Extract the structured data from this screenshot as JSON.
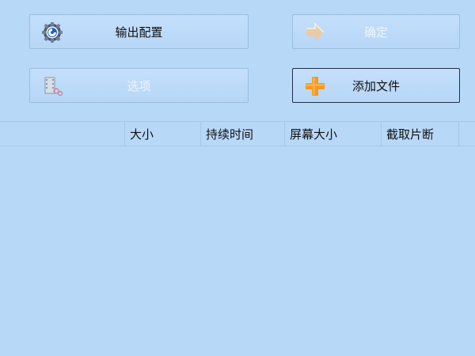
{
  "buttons": {
    "output_config": "输出配置",
    "confirm": "确定",
    "options": "选项",
    "add_file": "添加文件"
  },
  "table": {
    "columns": [
      "",
      "大小",
      "持续时间",
      "屏幕大小",
      "截取片断"
    ]
  },
  "icons": {
    "output_config": "gear-icon",
    "confirm": "arrow-right-icon",
    "options": "film-edit-icon",
    "add_file": "plus-icon"
  },
  "colors": {
    "background": "#b8d8f8",
    "border": "#9cbde0",
    "active_border": "#1e2f4a",
    "plus_orange": "#f39a1e"
  }
}
